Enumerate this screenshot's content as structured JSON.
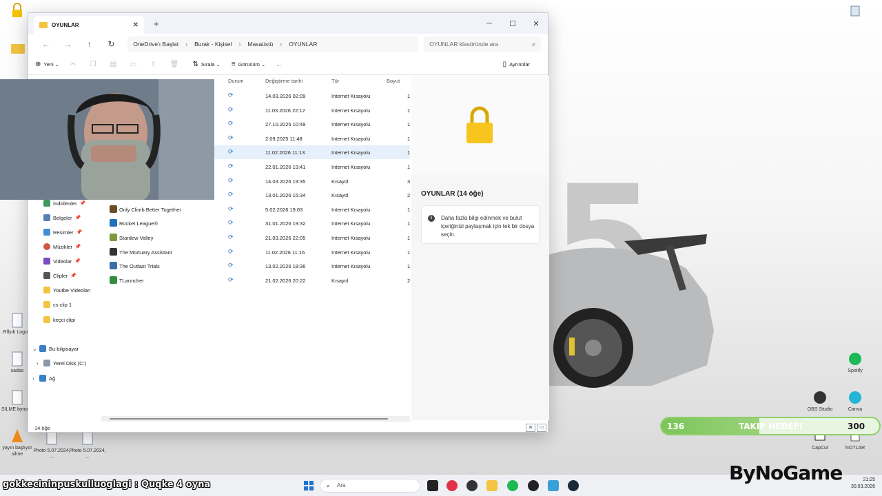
{
  "explorer": {
    "tab_title": "OYUNLAR",
    "breadcrumb": [
      "OneDrive'ı Başlat",
      "Burak - Kişisel",
      "Masaüstü",
      "OYUNLAR"
    ],
    "search_placeholder": "OYUNLAR klasöründe ara",
    "toolbar": {
      "new": "Yeni",
      "sort": "Sırala",
      "view": "Görünüm",
      "more": "...",
      "details": "Ayrıntılar"
    },
    "columns": {
      "status": "Durum",
      "modified": "Değiştirme tarihi",
      "type": "Tür",
      "size": "Boyut"
    },
    "nav": [
      {
        "label": "İndirilenler",
        "pinned": true
      },
      {
        "label": "Belgeler",
        "pinned": true
      },
      {
        "label": "Resimler",
        "pinned": true
      },
      {
        "label": "Müzikler",
        "pinned": true
      },
      {
        "label": "Videolar",
        "pinned": true
      },
      {
        "label": "Clipler",
        "pinned": true
      },
      {
        "label": "Youtbe Videoları",
        "pinned": false
      },
      {
        "label": "cs clip 1",
        "pinned": false
      },
      {
        "label": "keçci clipi",
        "pinned": false
      },
      {
        "label": "Bu bilgisayar",
        "pinned": false
      },
      {
        "label": "Yerel Disk (C:)",
        "pinned": false
      },
      {
        "label": "Ağ",
        "pinned": false
      }
    ],
    "files": [
      {
        "name": "",
        "modified": "14.03.2026 02:09",
        "type": "Internet Kısayolu",
        "size": "1"
      },
      {
        "name": "",
        "modified": "11.03.2026 22:12",
        "type": "Internet Kısayolu",
        "size": "1"
      },
      {
        "name": "",
        "modified": "27.10.2025 10:49",
        "type": "Internet Kısayolu",
        "size": "1"
      },
      {
        "name": "",
        "modified": "2.09.2025 11:48",
        "type": "Internet Kısayolu",
        "size": "1"
      },
      {
        "name": "",
        "modified": "11.02.2026 11:13",
        "type": "Internet Kısayolu",
        "size": "1"
      },
      {
        "name": "",
        "modified": "22.01.2026 19:41",
        "type": "Internet Kısayolu",
        "size": "1"
      },
      {
        "name": "",
        "modified": "14.03.2026 19:35",
        "type": "Kısayol",
        "size": "3"
      },
      {
        "name": "",
        "modified": "13.01.2026 15:34",
        "type": "Kısayol",
        "size": "2"
      },
      {
        "name": "Only Climb Better Together",
        "modified": "5.02.2026 19:03",
        "type": "Internet Kısayolu",
        "size": "1"
      },
      {
        "name": "Rocket League®",
        "modified": "31.01.2026 19:32",
        "type": "Internet Kısayolu",
        "size": "1"
      },
      {
        "name": "Stardew Valley",
        "modified": "21.03.2026 22:05",
        "type": "Internet Kısayolu",
        "size": "1"
      },
      {
        "name": "The Mortuary Assistant",
        "modified": "11.02.2026 11:16",
        "type": "Internet Kısayolu",
        "size": "1"
      },
      {
        "name": "The Outlast Trials",
        "modified": "13.02.2026 18:36",
        "type": "Internet Kısayolu",
        "size": "1"
      },
      {
        "name": "TLauncher",
        "modified": "21.02.2026 20:22",
        "type": "Kısayol",
        "size": "2"
      }
    ],
    "item_count": "14 öğe",
    "details_title": "OYUNLAR (14 öğe)",
    "details_info": "Daha fazla bilgi edinmek ve bulut içeriğinizi paylaşmak için tek bir dosya seçin."
  },
  "desktop_icons": {
    "left": [
      {
        "label": "Rflydı Logo.c"
      },
      {
        "label": "sadas"
      },
      {
        "label": "SİLME bynoga"
      },
      {
        "label": "yayın başlıyor silme"
      },
      {
        "label": "Photo 5.07.2024, ..."
      },
      {
        "label": "Photo 5.07.2024, ..."
      }
    ],
    "right": [
      {
        "label": "Spotify"
      },
      {
        "label": "OBS Studio"
      },
      {
        "label": "Canva"
      },
      {
        "label": "CapCut"
      },
      {
        "label": "NOTLAR"
      }
    ]
  },
  "goal": {
    "current": "136",
    "label": "TAKIP HEDEFI",
    "target": "300",
    "progress": 0.45
  },
  "taskbar": {
    "search_placeholder": "Ara",
    "clock_time": "21:25",
    "clock_date": "30.03.2026"
  },
  "overlay": {
    "chat": "gokkecininpuskulluoglagi : Quqke 4 oyna",
    "brand": "ByNoGame"
  },
  "colors": {
    "accent": "#2a6fc0",
    "folder": "#f3c441",
    "goal_green": "#7cc55a",
    "selection": "#e5f0fb"
  }
}
